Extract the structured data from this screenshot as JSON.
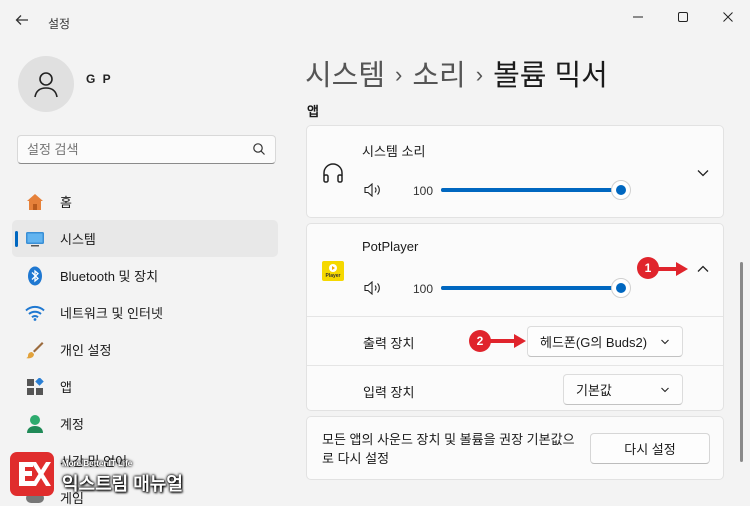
{
  "window": {
    "title": "설정",
    "back_icon": "arrow-left-icon",
    "controls": [
      "minimize-icon",
      "maximize-icon",
      "close-icon"
    ]
  },
  "profile": {
    "name": "G P"
  },
  "search": {
    "placeholder": "설정 검색"
  },
  "sidebar": {
    "items": [
      {
        "label": "홈",
        "icon": "home-icon",
        "active": false
      },
      {
        "label": "시스템",
        "icon": "monitor-icon",
        "active": true
      },
      {
        "label": "Bluetooth 및 장치",
        "icon": "bluetooth-icon",
        "active": false
      },
      {
        "label": "네트워크 및 인터넷",
        "icon": "wifi-icon",
        "active": false
      },
      {
        "label": "개인 설정",
        "icon": "brush-icon",
        "active": false
      },
      {
        "label": "앱",
        "icon": "apps-icon",
        "active": false
      },
      {
        "label": "계정",
        "icon": "account-icon",
        "active": false
      },
      {
        "label": "시간 및 언어",
        "icon": "globe-icon",
        "active": false
      },
      {
        "label": "게임",
        "icon": "game-icon",
        "active": false
      }
    ]
  },
  "breadcrumb": {
    "level1": "시스템",
    "level2": "소리",
    "current": "볼륨 믹서",
    "separator": "›"
  },
  "main": {
    "section_label": "앱",
    "system_sound": {
      "name": "시스템 소리",
      "volume": 100,
      "icon": "headphones-icon"
    },
    "potplayer": {
      "name": "PotPlayer",
      "volume": 100,
      "icon_label": "Player",
      "output_label": "출력 장치",
      "output_value": "헤드폰(G의 Buds2)",
      "input_label": "입력 장치",
      "input_value": "기본값"
    },
    "reset": {
      "text": "모든 앱의 사운드 장치 및 볼륨을 권장 기본값으로 다시 설정",
      "button": "다시 설정"
    }
  },
  "annotations": {
    "badge1": "1",
    "badge2": "2"
  },
  "watermark": {
    "tagline": "More Better IT Life",
    "name": "익스트림 매뉴얼"
  },
  "colors": {
    "accent": "#0067c0",
    "badge": "#e0242c",
    "brand": "#e02d2d"
  }
}
